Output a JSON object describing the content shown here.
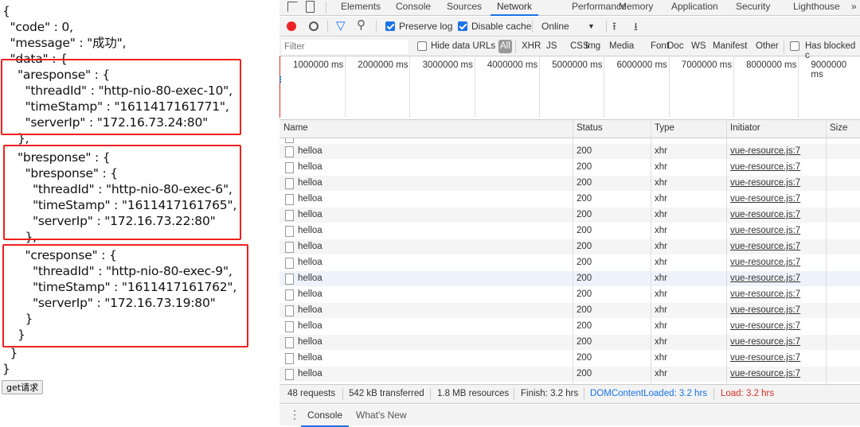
{
  "response_json": {
    "lines": [
      {
        "text": "{",
        "indent": 0
      },
      {
        "text": "\"code\" : 0,",
        "indent": 1
      },
      {
        "text": "\"message\" : \"成功\",",
        "indent": 1
      },
      {
        "text": "\"data\" : {",
        "indent": 1
      },
      {
        "text": "\"aresponse\" : {",
        "indent": 2
      },
      {
        "text": "\"threadId\" : \"http-nio-80-exec-10\",",
        "indent": 3
      },
      {
        "text": "\"timeStamp\" : \"1611417161771\",",
        "indent": 3
      },
      {
        "text": "\"serverIp\" : \"172.16.73.24:80\"",
        "indent": 3
      },
      {
        "text": "},",
        "indent": 2
      },
      {
        "text": "\"bresponse\" : {",
        "indent": 2
      },
      {
        "text": "\"bresponse\" : {",
        "indent": 3
      },
      {
        "text": "\"threadId\" : \"http-nio-80-exec-6\",",
        "indent": 4
      },
      {
        "text": "\"timeStamp\" : \"1611417161765\",",
        "indent": 4
      },
      {
        "text": "\"serverIp\" : \"172.16.73.22:80\"",
        "indent": 4
      },
      {
        "text": "},",
        "indent": 3
      },
      {
        "text": "\"cresponse\" : {",
        "indent": 3
      },
      {
        "text": "\"threadId\" : \"http-nio-80-exec-9\",",
        "indent": 4
      },
      {
        "text": "\"timeStamp\" : \"1611417161762\",",
        "indent": 4
      },
      {
        "text": "\"serverIp\" : \"172.16.73.19:80\"",
        "indent": 4
      },
      {
        "text": "}",
        "indent": 3
      },
      {
        "text": "}",
        "indent": 2
      },
      {
        "text": "}",
        "indent": 1
      },
      {
        "text": "}",
        "indent": 0
      }
    ],
    "button_label": "get请求",
    "highlight_color": "#f02020"
  },
  "devtools": {
    "tabs": [
      "Elements",
      "Console",
      "Sources",
      "Network",
      "Performance",
      "Memory",
      "Application",
      "Security",
      "Lighthouse"
    ],
    "active_tab": "Network",
    "toolbar": {
      "preserve_log": "Preserve log",
      "preserve_log_checked": true,
      "disable_cache": "Disable cache",
      "disable_cache_checked": true,
      "throttle": "Online"
    },
    "filter": {
      "placeholder": "Filter",
      "hide_data_urls": "Hide data URLs",
      "types": [
        "All",
        "XHR",
        "JS",
        "CSS",
        "Img",
        "Media",
        "Font",
        "Doc",
        "WS",
        "Manifest",
        "Other"
      ],
      "has_blocked": "Has blocked c"
    },
    "timeline_ticks": [
      "1000000 ms",
      "2000000 ms",
      "3000000 ms",
      "4000000 ms",
      "5000000 ms",
      "6000000 ms",
      "7000000 ms",
      "8000000 ms",
      "9000000 ms"
    ],
    "columns": [
      "Name",
      "Status",
      "Type",
      "Initiator",
      "Size"
    ],
    "rows": [
      {
        "name": "helloa",
        "status": "200",
        "type": "xhr",
        "initiator": "vue-resource.js:7"
      },
      {
        "name": "helloa",
        "status": "200",
        "type": "xhr",
        "initiator": "vue-resource.js:7"
      },
      {
        "name": "helloa",
        "status": "200",
        "type": "xhr",
        "initiator": "vue-resource.js:7"
      },
      {
        "name": "helloa",
        "status": "200",
        "type": "xhr",
        "initiator": "vue-resource.js:7"
      },
      {
        "name": "helloa",
        "status": "200",
        "type": "xhr",
        "initiator": "vue-resource.js:7"
      },
      {
        "name": "helloa",
        "status": "200",
        "type": "xhr",
        "initiator": "vue-resource.js:7"
      },
      {
        "name": "helloa",
        "status": "200",
        "type": "xhr",
        "initiator": "vue-resource.js:7"
      },
      {
        "name": "helloa",
        "status": "200",
        "type": "xhr",
        "initiator": "vue-resource.js:7"
      },
      {
        "name": "helloa",
        "status": "200",
        "type": "xhr",
        "initiator": "vue-resource.js:7"
      },
      {
        "name": "helloa",
        "status": "200",
        "type": "xhr",
        "initiator": "vue-resource.js:7"
      },
      {
        "name": "helloa",
        "status": "200",
        "type": "xhr",
        "initiator": "vue-resource.js:7"
      },
      {
        "name": "helloa",
        "status": "200",
        "type": "xhr",
        "initiator": "vue-resource.js:7"
      },
      {
        "name": "helloa",
        "status": "200",
        "type": "xhr",
        "initiator": "vue-resource.js:7"
      },
      {
        "name": "helloa",
        "status": "200",
        "type": "xhr",
        "initiator": "vue-resource.js:7"
      },
      {
        "name": "helloa",
        "status": "200",
        "type": "xhr",
        "initiator": "vue-resource.js:7"
      }
    ],
    "status_bar": {
      "requests": "48 requests",
      "transferred": "542 kB transferred",
      "resources": "1.8 MB resources",
      "finish": "Finish: 3.2 hrs",
      "dom_loaded": "DOMContentLoaded: 3.2 hrs",
      "load": "Load: 3.2 hrs",
      "dom_color": "#1a73e8",
      "load_color": "#d93025"
    },
    "drawer_tabs": [
      "Console",
      "What's New"
    ],
    "drawer_active": "Console"
  }
}
